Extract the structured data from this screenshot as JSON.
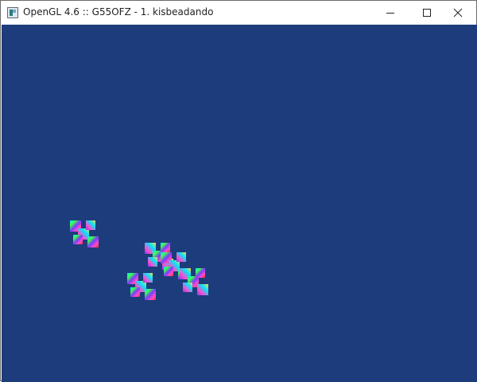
{
  "window": {
    "title": "OpenGL 4.6 :: G55OFZ - 1. kisbeadando",
    "icon": "opengl-app-icon"
  },
  "controls": {
    "minimize_icon": "minimize-icon",
    "maximize_icon": "maximize-icon",
    "close_icon": "close-icon"
  },
  "viewport": {
    "background_color": "#1d3c7b",
    "objects": [
      {
        "name": "x-shape-1",
        "colors": [
          "#ff4cc8",
          "#00e6ff",
          "#7a3cff",
          "#ff2a2a",
          "#3cff4a",
          "#ffd84a"
        ]
      },
      {
        "name": "x-shape-2",
        "colors": [
          "#ff4cc8",
          "#00e6ff",
          "#7a3cff",
          "#ff2a2a",
          "#3cff4a",
          "#ffd84a"
        ]
      },
      {
        "name": "x-shape-3",
        "colors": [
          "#ff4cc8",
          "#00e6ff",
          "#7a3cff",
          "#ff2a2a",
          "#3cff4a",
          "#ffd84a"
        ]
      },
      {
        "name": "x-shape-4",
        "colors": [
          "#ff4cc8",
          "#00e6ff",
          "#7a3cff",
          "#ff2a2a",
          "#3cff4a",
          "#ffd84a"
        ]
      },
      {
        "name": "x-shape-5",
        "colors": [
          "#ff4cc8",
          "#00e6ff",
          "#7a3cff",
          "#ff2a2a",
          "#3cff4a",
          "#ffd84a"
        ]
      }
    ]
  }
}
